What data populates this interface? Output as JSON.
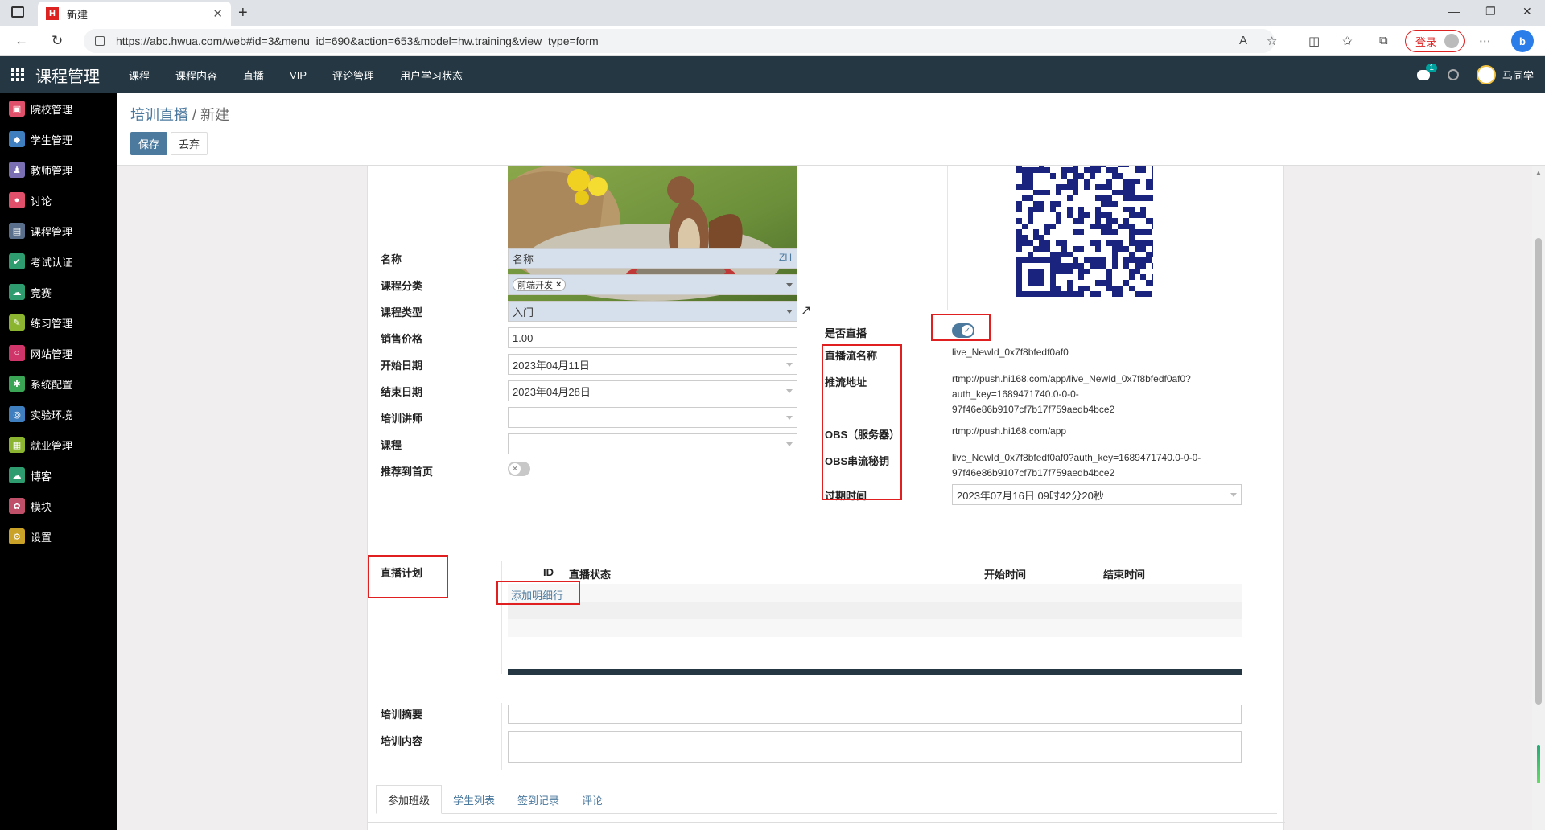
{
  "browser": {
    "tab_title": "新建",
    "favicon_letter": "H",
    "url": "https://abc.hwua.com/web#id=3&menu_id=690&action=653&model=hw.training&view_type=form",
    "login_label": "登录",
    "bing_letter": "b"
  },
  "app": {
    "brand": "课程管理",
    "menu": [
      "课程",
      "课程内容",
      "直播",
      "VIP",
      "评论管理",
      "用户学习状态"
    ],
    "chat_count": "1",
    "user_name": "马同学"
  },
  "sidebar": {
    "items": [
      {
        "label": "院校管理",
        "icon": "building-icon",
        "color": "#e0506a"
      },
      {
        "label": "学生管理",
        "icon": "graduation-cap-icon",
        "color": "#3f7fbf"
      },
      {
        "label": "教师管理",
        "icon": "teacher-icon",
        "color": "#7b6fb3"
      },
      {
        "label": "讨论",
        "icon": "chat-bubble-icon",
        "color": "#e0506a"
      },
      {
        "label": "课程管理",
        "icon": "course-icon",
        "color": "#5a6f8c"
      },
      {
        "label": "考试认证",
        "icon": "shield-check-icon",
        "color": "#2e9c6e"
      },
      {
        "label": "竞赛",
        "icon": "cloud-icon",
        "color": "#2e9c6e"
      },
      {
        "label": "练习管理",
        "icon": "practice-icon",
        "color": "#8bb531"
      },
      {
        "label": "网站管理",
        "icon": "globe-ring-icon",
        "color": "#d0356a"
      },
      {
        "label": "系统配置",
        "icon": "tools-icon",
        "color": "#3aa655"
      },
      {
        "label": "实验环境",
        "icon": "lab-icon",
        "color": "#3f7fbf"
      },
      {
        "label": "就业管理",
        "icon": "job-icon",
        "color": "#8bb531"
      },
      {
        "label": "博客",
        "icon": "cloud-icon",
        "color": "#2e9c6e"
      },
      {
        "label": "模块",
        "icon": "modules-icon",
        "color": "#c0506a"
      },
      {
        "label": "设置",
        "icon": "gear-icon",
        "color": "#c9a227"
      }
    ]
  },
  "control": {
    "breadcrumb_parent": "培训直播",
    "breadcrumb_sep": " / ",
    "breadcrumb_current": "新建",
    "save_label": "保存",
    "discard_label": "丢弃"
  },
  "form": {
    "name_label": "名称",
    "name_value": "名称",
    "lang_tag": "ZH",
    "category_label": "课程分类",
    "category_tag": "前端开发",
    "type_label": "课程类型",
    "type_value": "入门",
    "price_label": "销售价格",
    "price_value": "1.00",
    "start_label": "开始日期",
    "start_value": "2023年04月11日",
    "end_label": "结束日期",
    "end_value": "2023年04月28日",
    "teacher_label": "培训讲师",
    "teacher_value": "",
    "course_label": "课程",
    "course_value": "",
    "recommend_label": "推荐到首页",
    "recommend_on": false,
    "is_live_label": "是否直播",
    "is_live_on": true,
    "stream_name_label": "直播流名称",
    "stream_name_value": "live_NewId_0x7f8bfedf0af0",
    "push_url_label": "推流地址",
    "push_url_line1": "rtmp://push.hi168.com/app/live_NewId_0x7f8bfedf0af0?",
    "push_url_line2": "auth_key=1689471740.0-0-0-",
    "push_url_line3": "97f46e86b9107cf7b17f759aedb4bce2",
    "obs_server_label": "OBS（服务器）",
    "obs_server_value": "rtmp://push.hi168.com/app",
    "obs_key_label": "OBS串流秘钥",
    "obs_key_line1": "live_NewId_0x7f8bfedf0af0?auth_key=1689471740.0-0-0-",
    "obs_key_line2": "97f46e86b9107cf7b17f759aedb4bce2",
    "expire_label": "过期时间",
    "expire_value": "2023年07月16日 09时42分20秒",
    "plan_label": "直播计划",
    "plan_columns": {
      "id": "ID",
      "status": "直播状态",
      "start": "开始时间",
      "end": "结束时间"
    },
    "add_line_label": "添加明细行",
    "summary_label": "培训摘要",
    "summary_value": "",
    "content_label": "培训内容",
    "content_value": ""
  },
  "tabs": [
    "参加班级",
    "学生列表",
    "签到记录",
    "评论"
  ]
}
